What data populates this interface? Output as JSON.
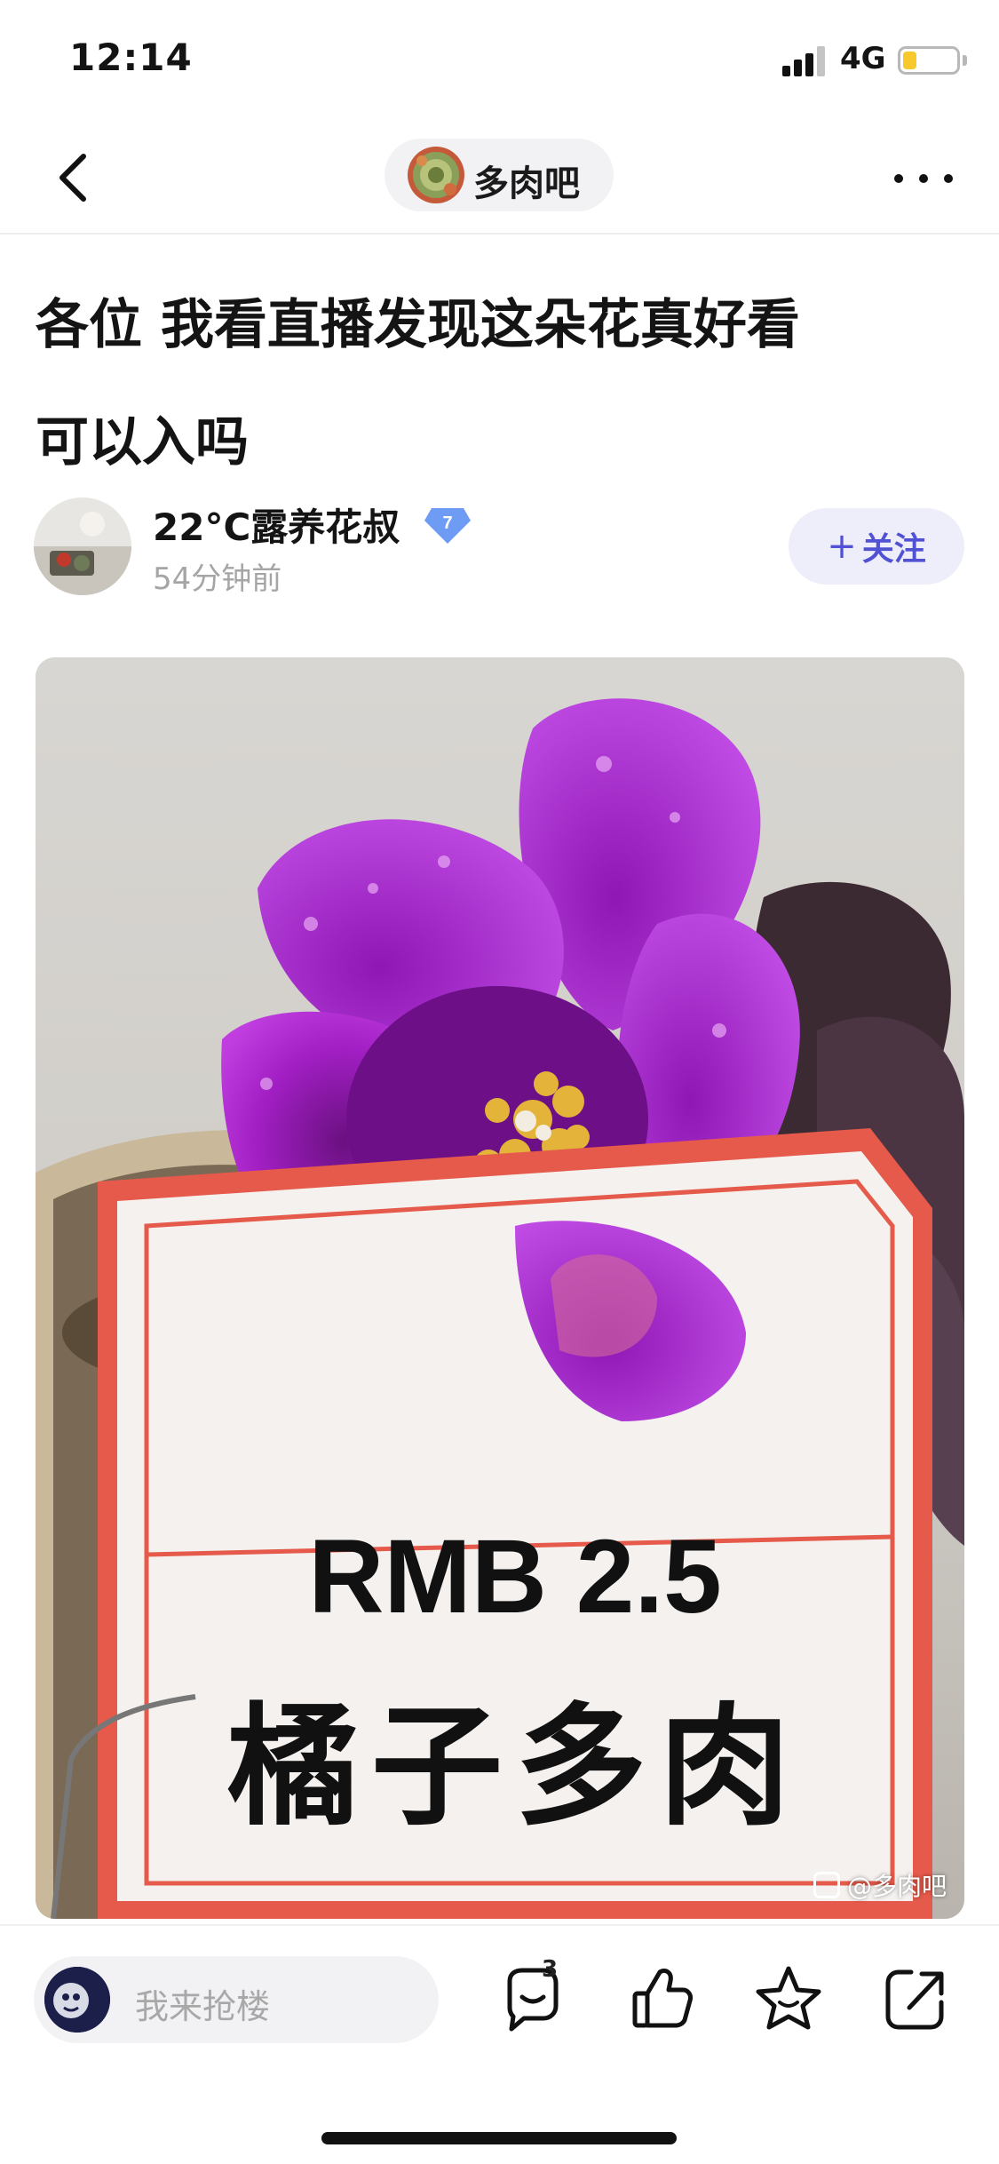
{
  "status_bar": {
    "time": "12:14",
    "network": "4G",
    "battery_level": 0.25,
    "battery_color": "#f7c92a"
  },
  "nav": {
    "back_icon": "chevron-left-icon",
    "forum_name": "多肉吧",
    "more_icon": "more-horizontal-icon"
  },
  "post": {
    "title": "各位 我看直播发现这朵花真好看可以入吗",
    "author": {
      "name": "22°C露养花叔",
      "level": "7",
      "time": "54分钟前"
    },
    "follow": {
      "plus": "+",
      "label": "关注"
    },
    "image": {
      "price_label": "RMB 2.5",
      "name_label": "橘子多肉",
      "watermark": "@多肉吧"
    }
  },
  "bottom_bar": {
    "reply_placeholder": "我来抢楼",
    "comment_count": "3",
    "icons": [
      "comment-icon",
      "like-icon",
      "favorite-icon",
      "share-icon"
    ]
  },
  "colors": {
    "accent": "#5151d4",
    "follow_bg": "#eeeefb",
    "badge": "#6e9cf5"
  }
}
